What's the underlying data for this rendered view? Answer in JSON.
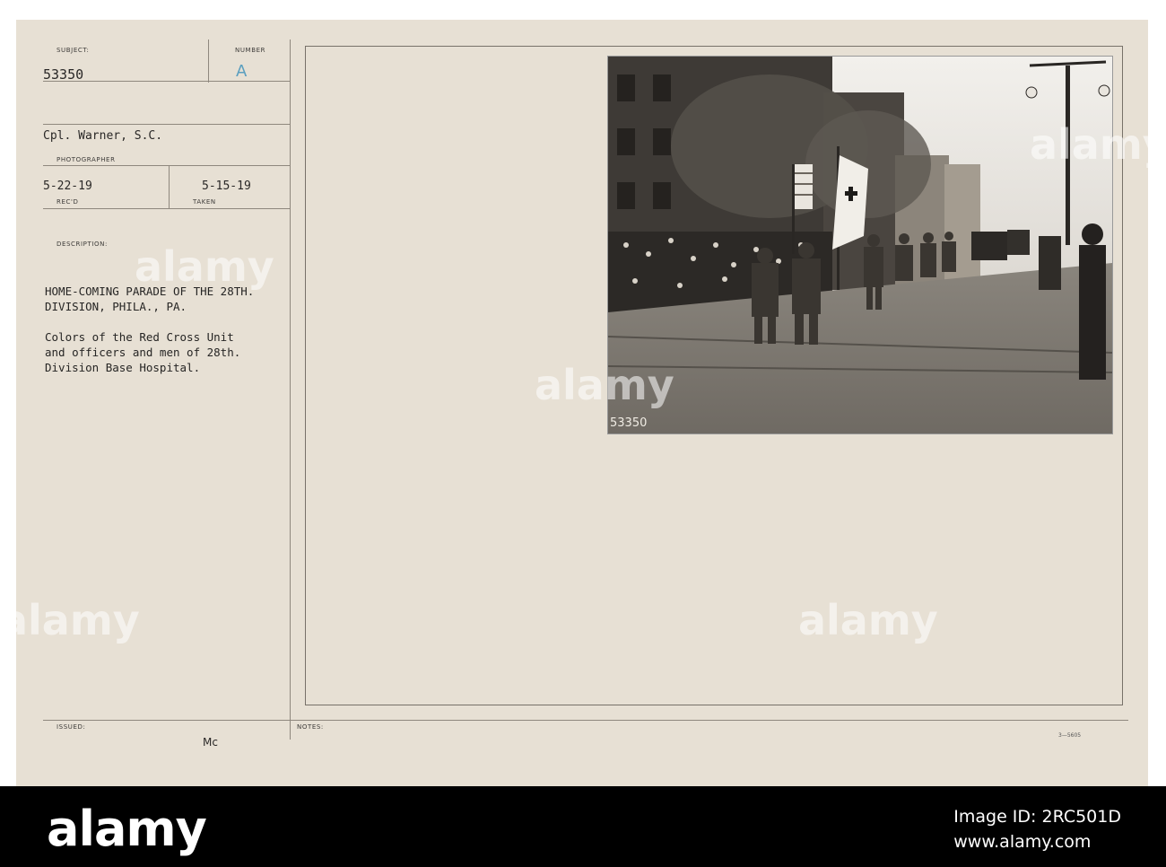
{
  "card": {
    "subject_label": "SUBJECT:",
    "number_label": "NUMBER",
    "subject_number": "53350",
    "number_value": "A",
    "photographer": "Cpl. Warner, S.C.",
    "photographer_label": "PHOTOGRAPHER",
    "received_date": "5-22-19",
    "received_label": "REC'D",
    "taken_date": "5-15-19",
    "taken_label": "TAKEN",
    "description_label": "DESCRIPTION:",
    "description_title": "HOME-COMING PARADE OF THE 28TH.\nDIVISION, PHILA., PA.",
    "description_body": "Colors of the Red Cross Unit\nand officers and men of 28th.\nDivision Base Hospital.",
    "issued_label": "ISSUED:",
    "issued_initials": "Mc",
    "notes_label": "NOTES:",
    "form_code": "3—5605"
  },
  "photo": {
    "caption_number": "53350"
  },
  "watermark": {
    "text": "alamy"
  },
  "footer": {
    "logo_text": "alamy",
    "image_id_line": "Image ID: 2RC501D",
    "url_line": "www.alamy.com"
  }
}
